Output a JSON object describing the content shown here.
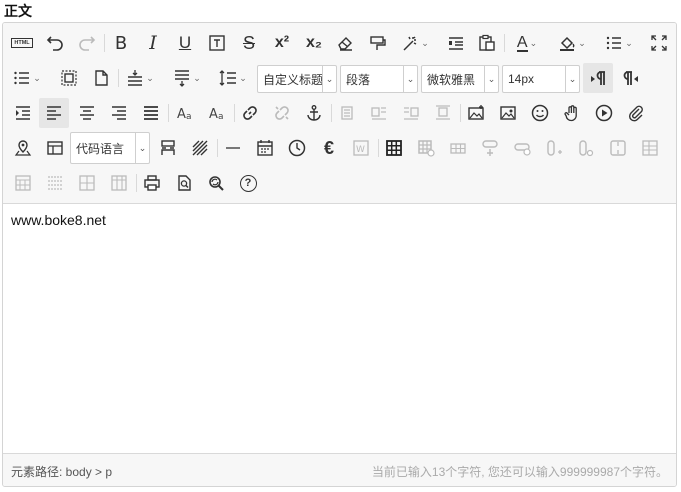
{
  "field": {
    "label": "正文"
  },
  "toolbar": {
    "selects": {
      "heading": "自定义标题",
      "paragraph": "段落",
      "font_family": "微软雅黑",
      "font_size": "14px",
      "code_language": "代码语言"
    },
    "glyphs": {
      "html": "HTML",
      "bold": "B",
      "italic": "I",
      "underline": "U",
      "strike": "S",
      "sup": "x²",
      "sub": "x₂",
      "font_color": "A",
      "euro": "€",
      "question": "?"
    }
  },
  "content": {
    "text": "www.boke8.net"
  },
  "status": {
    "path": "元素路径: body > p",
    "count": "当前已输入13个字符, 您还可以输入999999987个字符。"
  }
}
